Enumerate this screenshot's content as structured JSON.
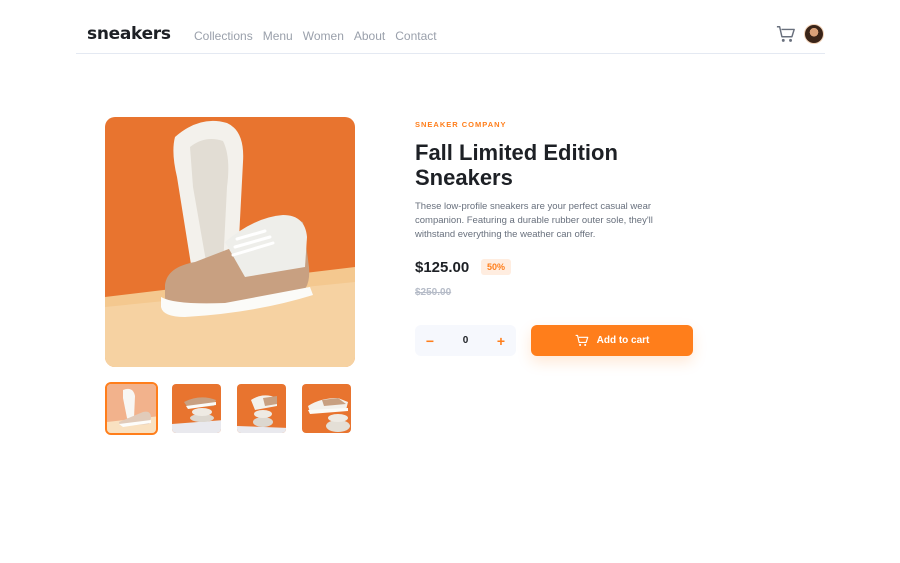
{
  "brand": {
    "logo": "sneakers"
  },
  "nav": [
    "Collections",
    "Menu",
    "Women",
    "About",
    "Contact"
  ],
  "product": {
    "company": "SNEAKER COMPANY",
    "title": "Fall Limited Edition Sneakers",
    "description": "These low-profile sneakers are your perfect casual wear companion. Featuring a durable rubber outer sole, they'll withstand everything the weather can offer.",
    "price": "$125.00",
    "discount": "50%",
    "original_price": "$250.00"
  },
  "cart": {
    "quantity": "0",
    "minus": "−",
    "plus": "+",
    "add_label": "Add to cart"
  },
  "gallery": {
    "active_index": 0,
    "thumbnail_count": 4
  },
  "colors": {
    "accent": "#ff7e1b",
    "accent_pale": "#ffede0",
    "text_dark": "#1d2025",
    "text_muted": "#68707d",
    "nav_text": "#9aa0ab"
  }
}
